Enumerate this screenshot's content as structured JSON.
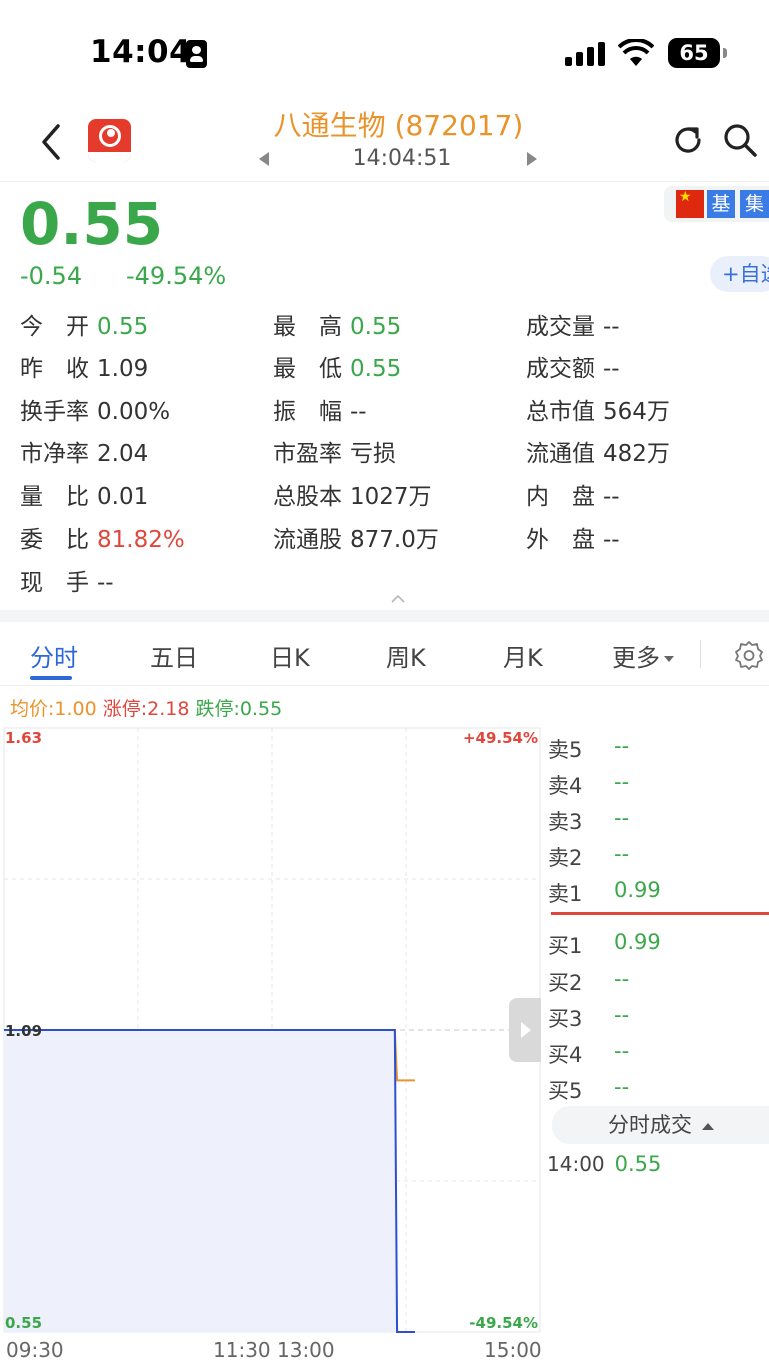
{
  "status_bar": {
    "time": "14:04",
    "battery": "65"
  },
  "header": {
    "title": "八通生物 (872017)",
    "timestamp": "14:04:51"
  },
  "quote": {
    "price": "0.55",
    "change": "-0.54",
    "change_pct": "-49.54%",
    "tags": [
      "基",
      "集"
    ],
    "add_watch": "+自选"
  },
  "stats": {
    "open_label": "今　开",
    "open": "0.55",
    "high_label": "最　高",
    "high": "0.55",
    "volume_label": "成交量",
    "volume": "--",
    "prev_close_label": "昨　收",
    "prev_close": "1.09",
    "low_label": "最　低",
    "low": "0.55",
    "amount_label": "成交额",
    "amount": "--",
    "turnover_label": "换手率",
    "turnover": "0.00%",
    "amplitude_label": "振　幅",
    "amplitude": "--",
    "mktcap_label": "总市值",
    "mktcap": "564万",
    "pb_label": "市净率",
    "pb": "2.04",
    "pe_label": "市盈率",
    "pe": "亏损",
    "float_cap_label": "流通值",
    "float_cap": "482万",
    "vol_ratio_label": "量　比",
    "vol_ratio": "0.01",
    "total_shares_label": "总股本",
    "total_shares": "1027万",
    "inner_label": "内　盘",
    "inner": "--",
    "bid_ratio_label": "委　比",
    "bid_ratio": "81.82%",
    "float_shares_label": "流通股",
    "float_shares": "877.0万",
    "outer_label": "外　盘",
    "outer": "--",
    "current_hand_label": "现　手",
    "current_hand": "--"
  },
  "tabs": [
    "分时",
    "五日",
    "日K",
    "周K",
    "月K",
    "更多"
  ],
  "legend": {
    "avg": "均价:1.00",
    "limit_up": "涨停:2.18",
    "limit_down": "跌停:0.55"
  },
  "chart_data": {
    "type": "line",
    "y_left_labels": [
      "1.63",
      "1.09",
      "0.55"
    ],
    "y_right_labels": [
      "+49.54%",
      "-49.54%"
    ],
    "x_tick_labels": [
      "09:30",
      "11:30 13:00",
      "15:00"
    ],
    "ylim": [
      0.55,
      1.63
    ],
    "prev_close": 1.09,
    "series": [
      {
        "name": "price",
        "color": "#2d4fd0",
        "points": [
          [
            "09:30",
            1.09
          ],
          [
            "13:55",
            1.09
          ],
          [
            "13:56",
            0.55
          ],
          [
            "14:04",
            0.55
          ]
        ]
      },
      {
        "name": "average",
        "color": "#e8942b",
        "points": [
          [
            "09:30",
            1.09
          ],
          [
            "13:55",
            1.09
          ],
          [
            "13:56",
            1.0
          ],
          [
            "14:04",
            1.0
          ]
        ]
      }
    ]
  },
  "order_book": {
    "asks": [
      {
        "label": "卖5",
        "price": "--"
      },
      {
        "label": "卖4",
        "price": "--"
      },
      {
        "label": "卖3",
        "price": "--"
      },
      {
        "label": "卖2",
        "price": "--"
      },
      {
        "label": "卖1",
        "price": "0.99"
      }
    ],
    "bids": [
      {
        "label": "买1",
        "price": "0.99"
      },
      {
        "label": "买2",
        "price": "--"
      },
      {
        "label": "买3",
        "price": "--"
      },
      {
        "label": "买4",
        "price": "--"
      },
      {
        "label": "买5",
        "price": "--"
      }
    ],
    "trades_title": "分时成交",
    "trades": [
      {
        "time": "14:00",
        "price": "0.55"
      }
    ]
  },
  "colors": {
    "up": "#e0473c",
    "down": "#3aa84a",
    "accent": "#2d67d8",
    "title": "#e8942b"
  }
}
